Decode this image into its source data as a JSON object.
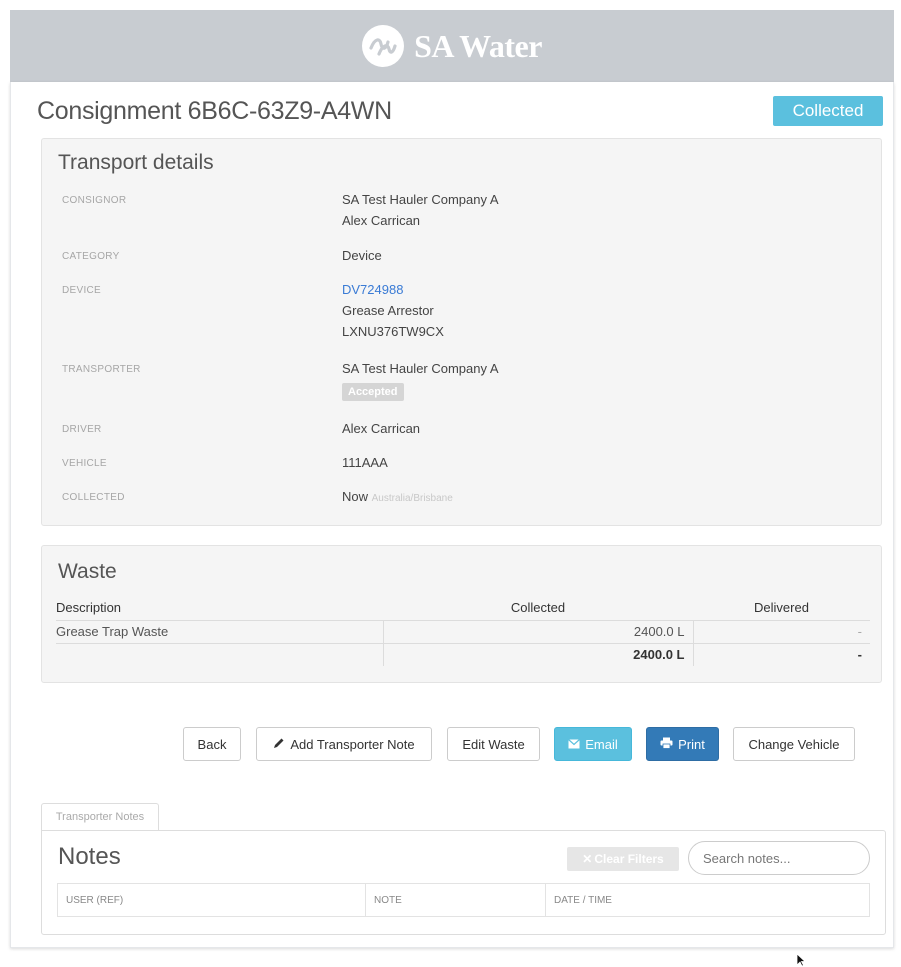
{
  "brand": {
    "name": "SA Water",
    "logo_icon": "wave-logo-icon"
  },
  "consignment": {
    "title": "Consignment 6B6C-63Z9-A4WN",
    "status": "Collected"
  },
  "transport": {
    "heading": "Transport details",
    "consignor_label": "CONSIGNOR",
    "consignor_company": "SA Test Hauler Company A",
    "consignor_person": "Alex Carrican",
    "category_label": "CATEGORY",
    "category_value": "Device",
    "device_label": "DEVICE",
    "device_id": "DV724988",
    "device_type": "Grease Arrestor",
    "device_serial": "LXNU376TW9CX",
    "transporter_label": "TRANSPORTER",
    "transporter_company": "SA Test Hauler Company A",
    "transporter_status": "Accepted",
    "driver_label": "DRIVER",
    "driver_value": "Alex Carrican",
    "vehicle_label": "VEHICLE",
    "vehicle_value": "111AAA",
    "collected_label": "COLLECTED",
    "collected_value": "Now",
    "collected_tz": "Australia/Brisbane"
  },
  "waste": {
    "heading": "Waste",
    "columns": [
      "Description",
      "Collected",
      "Delivered"
    ],
    "rows": [
      {
        "description": "Grease Trap Waste",
        "collected": "2400.0 L",
        "delivered": "-"
      }
    ],
    "total": {
      "collected": "2400.0 L",
      "delivered": "-"
    }
  },
  "actions": {
    "back": "Back",
    "add_note": "Add Transporter Note",
    "edit_waste": "Edit Waste",
    "email": "Email",
    "print": "Print",
    "change_vehicle": "Change Vehicle"
  },
  "notes": {
    "tab_label": "Transporter Notes",
    "heading": "Notes",
    "clear_filters": "Clear Filters",
    "search_placeholder": "Search notes...",
    "columns": [
      "USER (REF)",
      "NOTE",
      "DATE / TIME"
    ]
  },
  "colors": {
    "header_bg": "#c8ccd1",
    "info": "#5bc0de",
    "primary": "#337ab7",
    "link": "#3a7bd5"
  }
}
